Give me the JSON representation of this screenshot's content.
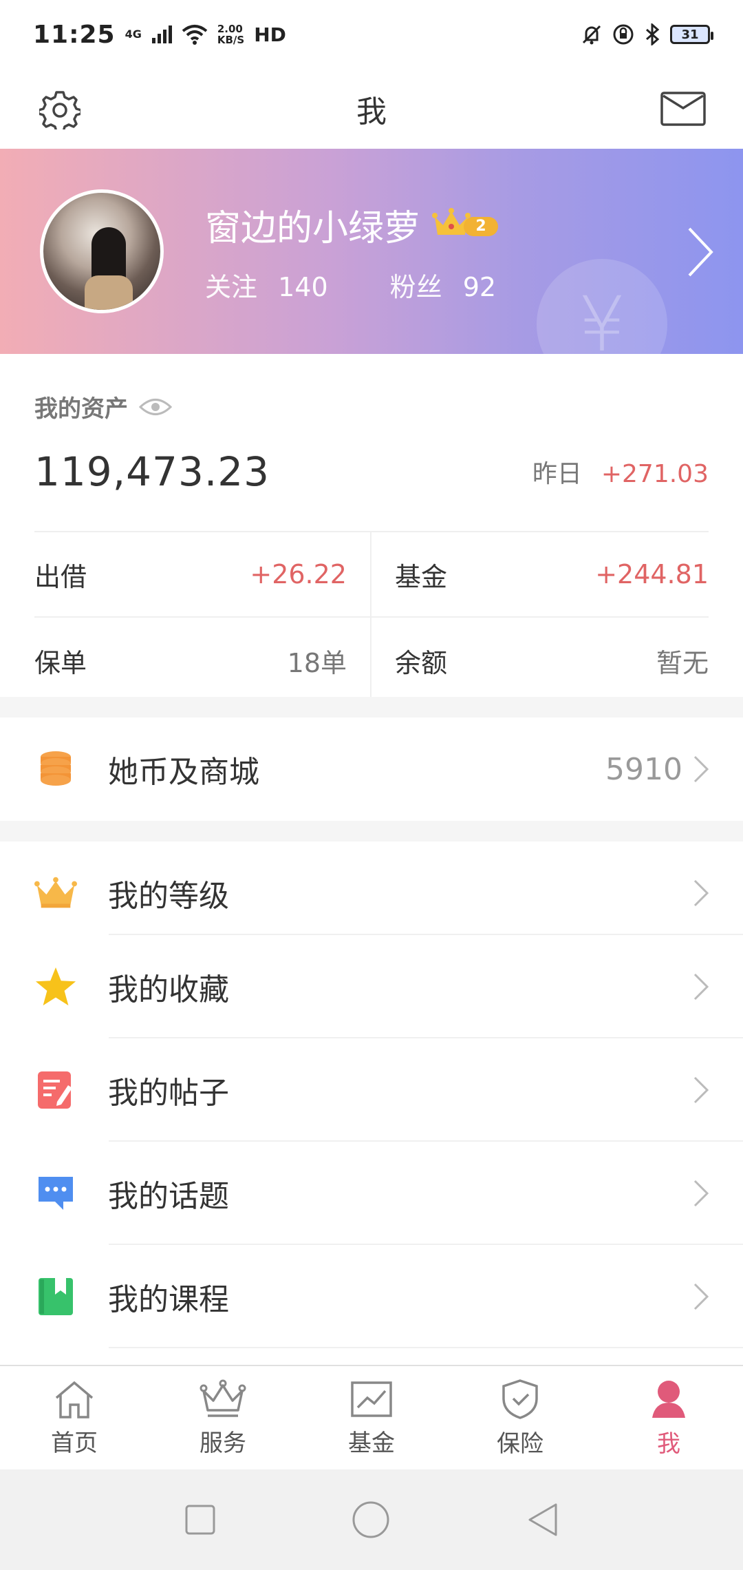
{
  "status_bar": {
    "time": "11:25",
    "network": "4G",
    "speed_value": "2.00",
    "speed_unit": "KB/S",
    "hd": "HD",
    "battery": "31"
  },
  "header": {
    "title": "我"
  },
  "profile": {
    "name": "窗边的小绿萝",
    "level": "2",
    "follow_label": "关注",
    "follow_count": "140",
    "fans_label": "粉丝",
    "fans_count": "92",
    "watermark": "¥"
  },
  "assets": {
    "label": "我的资产",
    "total": "119,473.23",
    "yesterday_label": "昨日",
    "yesterday_change": "+271.03",
    "items": [
      {
        "name": "出借",
        "value": "+26.22"
      },
      {
        "name": "基金",
        "value": "+244.81"
      },
      {
        "name": "保单",
        "value": "18单"
      },
      {
        "name": "余额",
        "value": "暂无"
      }
    ]
  },
  "coin_row": {
    "label": "她币及商城",
    "value": "5910"
  },
  "menu": [
    {
      "label": "我的等级"
    },
    {
      "label": "我的收藏"
    },
    {
      "label": "我的帖子"
    },
    {
      "label": "我的话题"
    },
    {
      "label": "我的课程"
    }
  ],
  "bottom_nav": [
    {
      "label": "首页"
    },
    {
      "label": "服务"
    },
    {
      "label": "基金"
    },
    {
      "label": "保险"
    },
    {
      "label": "我"
    }
  ],
  "colors": {
    "accent_red": "#e06464",
    "active_tab": "#e05a7a",
    "banner_start": "#f2adb5",
    "banner_end": "#8d95ef"
  }
}
